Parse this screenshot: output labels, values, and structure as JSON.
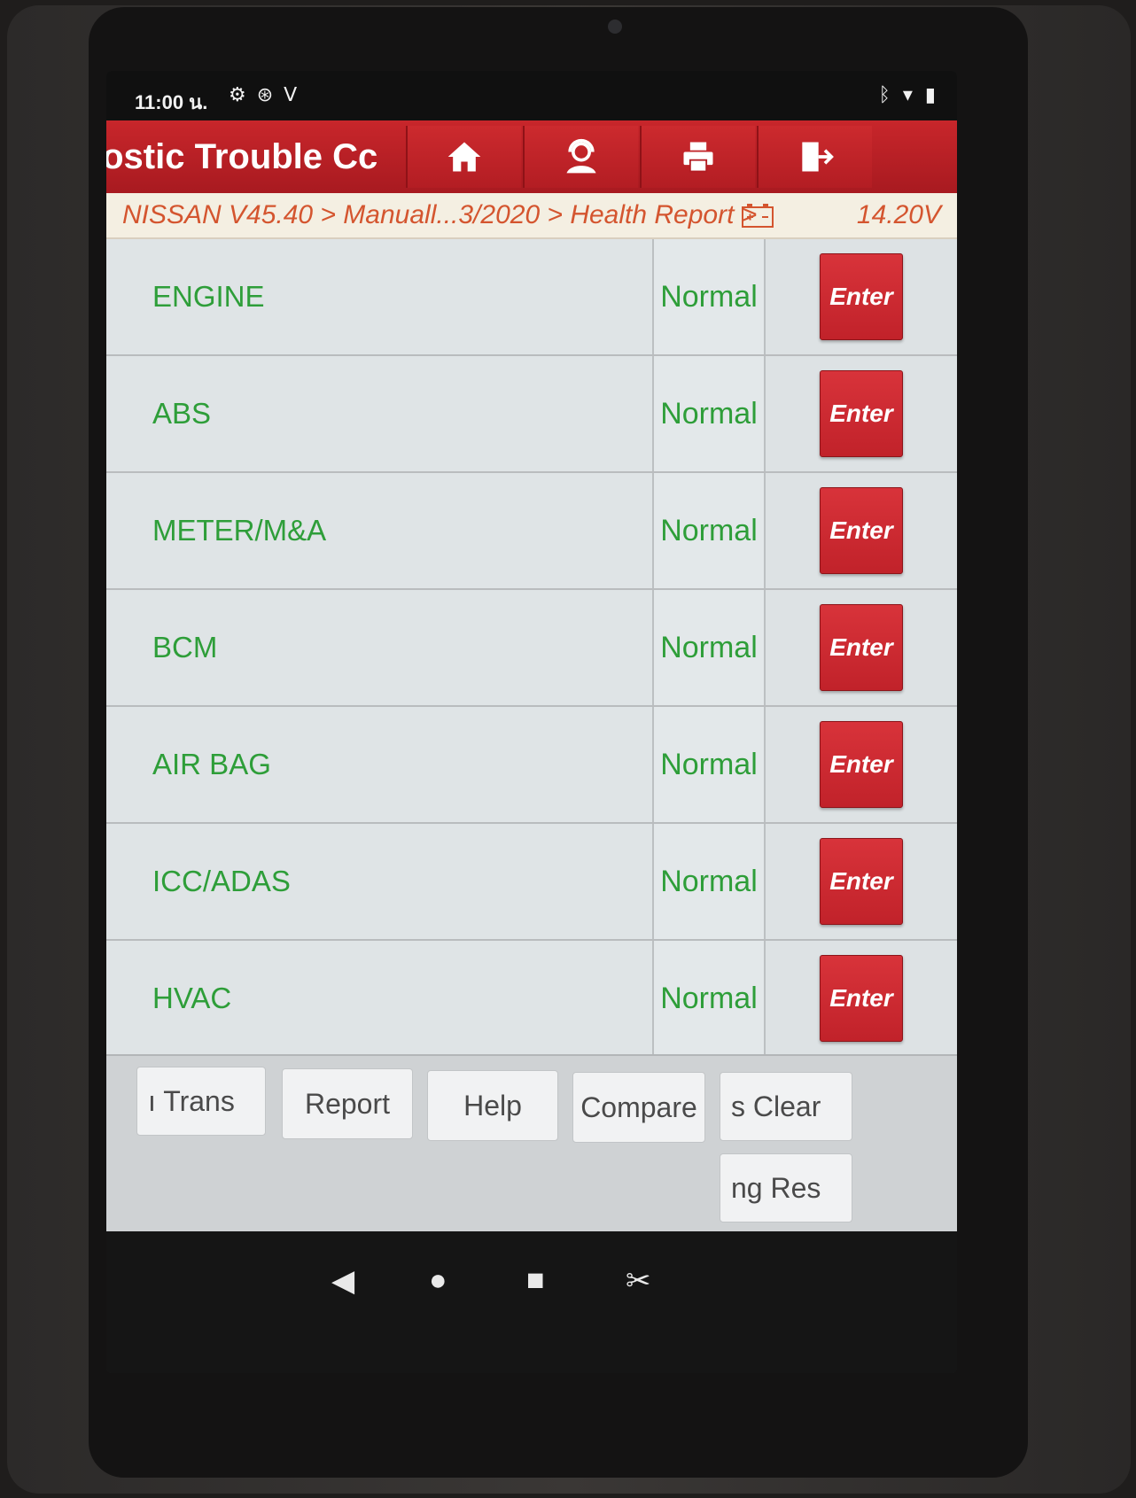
{
  "status_bar": {
    "time": "11:00 น.",
    "left_icons": [
      "gear-icon",
      "recording-icon",
      "stethoscope-icon"
    ],
    "right_icons": [
      "bluetooth-icon",
      "wifi-icon",
      "battery-icon"
    ]
  },
  "header": {
    "title": "iostic Trouble Cc",
    "buttons": [
      "home-icon",
      "support-agent-icon",
      "print-icon",
      "exit-icon"
    ]
  },
  "breadcrumb": {
    "path": "NISSAN V45.40 > Manuall...3/2020 > Health Report >",
    "voltage": "14.20V"
  },
  "systems": [
    {
      "name": "ENGINE",
      "status": "Normal",
      "action": "Enter"
    },
    {
      "name": "ABS",
      "status": "Normal",
      "action": "Enter"
    },
    {
      "name": "METER/M&A",
      "status": "Normal",
      "action": "Enter"
    },
    {
      "name": "BCM",
      "status": "Normal",
      "action": "Enter"
    },
    {
      "name": "AIR BAG",
      "status": "Normal",
      "action": "Enter"
    },
    {
      "name": "ICC/ADAS",
      "status": "Normal",
      "action": "Enter"
    },
    {
      "name": "HVAC",
      "status": "Normal",
      "action": "Enter"
    }
  ],
  "toolbar": {
    "trans": "ı   Trans",
    "report": "Report",
    "help": "Help",
    "compare": "Compare",
    "clear": "s    Clear",
    "reset": "ng     Res"
  },
  "nav": [
    "back-icon",
    "home-circle-icon",
    "recents-icon",
    "screenshot-icon"
  ]
}
